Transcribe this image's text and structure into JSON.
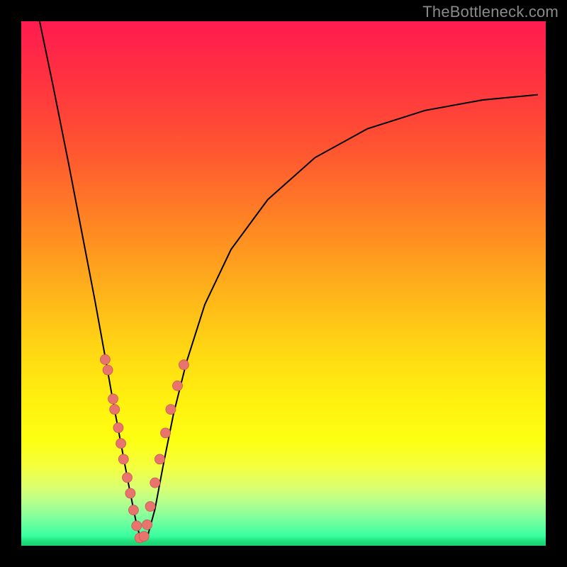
{
  "watermark": "TheBottleneck.com",
  "chart_data": {
    "type": "line",
    "title": "",
    "xlabel": "",
    "ylabel": "",
    "xlim": [
      0,
      1
    ],
    "ylim": [
      0,
      1
    ],
    "note": "Axes are unlabeled; values are normalized 0–1 estimates read from pixel positions. The curve is a V-shaped bottleneck profile reaching its minimum (≈0) near x≈0.225. Dots mark sample points clustered on both flanks of the minimum.",
    "series": [
      {
        "name": "bottleneck-curve",
        "x": [
          0.035,
          0.06,
          0.09,
          0.115,
          0.14,
          0.16,
          0.175,
          0.19,
          0.205,
          0.218,
          0.228,
          0.24,
          0.255,
          0.27,
          0.29,
          0.315,
          0.35,
          0.4,
          0.47,
          0.56,
          0.66,
          0.77,
          0.88,
          0.985
        ],
        "y": [
          1.0,
          0.88,
          0.73,
          0.6,
          0.47,
          0.36,
          0.275,
          0.195,
          0.115,
          0.05,
          0.01,
          0.015,
          0.07,
          0.15,
          0.25,
          0.35,
          0.46,
          0.565,
          0.66,
          0.74,
          0.795,
          0.83,
          0.85,
          0.86
        ]
      },
      {
        "name": "sample-dots",
        "x": [
          0.16,
          0.165,
          0.175,
          0.178,
          0.185,
          0.19,
          0.195,
          0.202,
          0.208,
          0.214,
          0.22,
          0.226,
          0.234,
          0.24,
          0.246,
          0.255,
          0.264,
          0.275,
          0.285,
          0.298,
          0.31
        ],
        "y": [
          0.355,
          0.335,
          0.28,
          0.26,
          0.225,
          0.195,
          0.165,
          0.13,
          0.1,
          0.068,
          0.038,
          0.015,
          0.018,
          0.04,
          0.075,
          0.12,
          0.165,
          0.215,
          0.26,
          0.305,
          0.345
        ]
      }
    ]
  },
  "colors": {
    "dot_fill": "#e9746d",
    "dot_stroke": "#c45b55",
    "curve": "#000000",
    "gradient_top": "#ff1b50",
    "gradient_mid": "#fff20f",
    "gradient_bottom": "#1dd070",
    "frame": "#000000",
    "watermark": "#8a8a8a"
  }
}
